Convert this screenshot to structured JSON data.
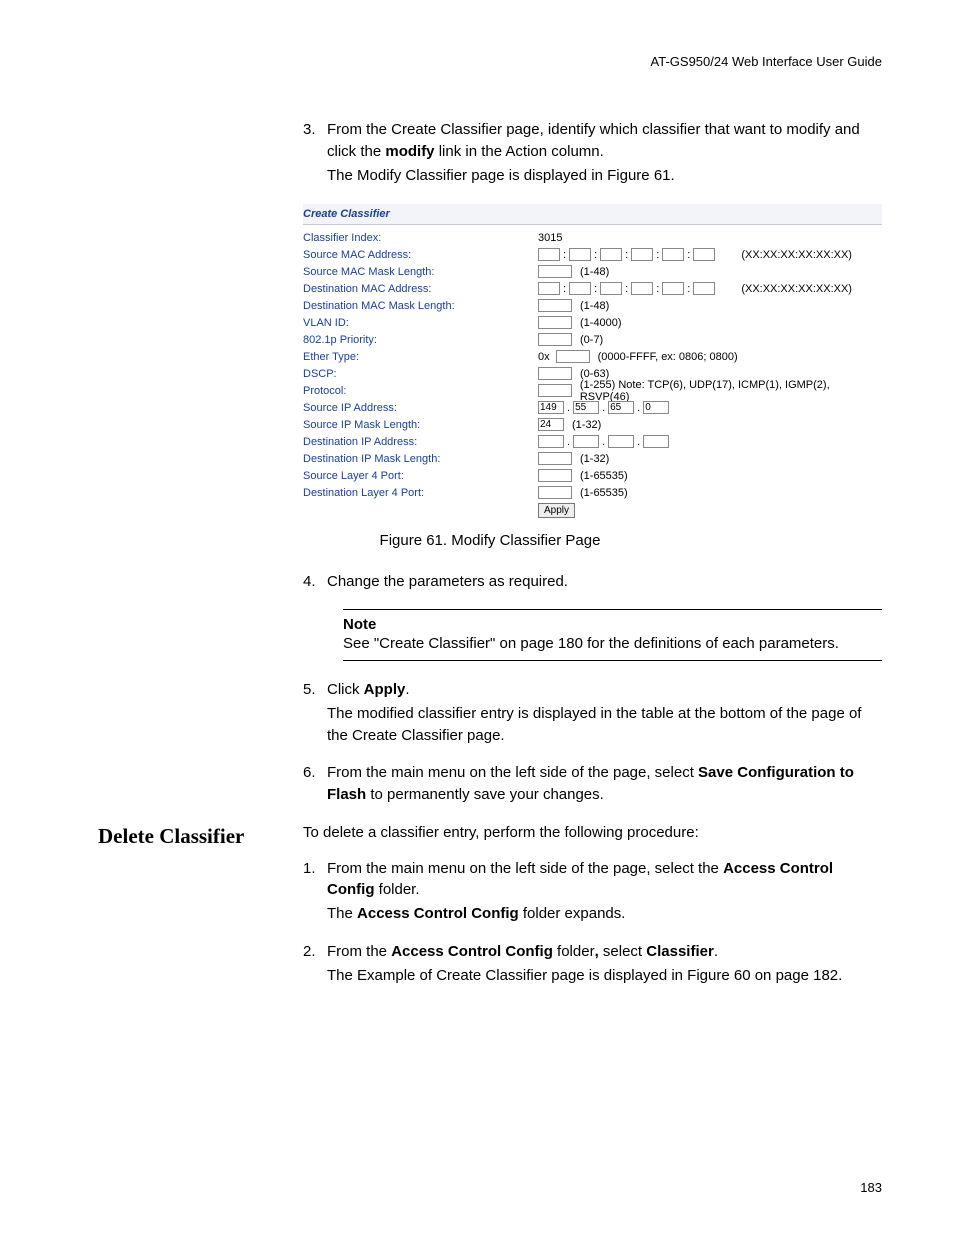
{
  "header": {
    "guide": "AT-GS950/24 Web Interface User Guide"
  },
  "step3": {
    "num": "3.",
    "line1a": "From the Create Classifier page, identify which classifier that want to modify and click the ",
    "bold1": "modify",
    "line1b": " link in the Action column.",
    "line2": "The Modify Classifier page is displayed in Figure 61."
  },
  "form": {
    "title": "Create Classifier",
    "rows": {
      "classifier_index": {
        "label": "Classifier Index:",
        "value": "3015"
      },
      "src_mac": {
        "label": "Source MAC Address:",
        "hint": "(XX:XX:XX:XX:XX:XX)"
      },
      "src_mac_mask": {
        "label": "Source MAC Mask Length:",
        "hint": "(1-48)"
      },
      "dst_mac": {
        "label": "Destination MAC Address:",
        "hint": "(XX:XX:XX:XX:XX:XX)"
      },
      "dst_mac_mask": {
        "label": "Destination MAC Mask Length:",
        "hint": "(1-48)"
      },
      "vlan": {
        "label": "VLAN ID:",
        "hint": "(1-4000)"
      },
      "prio": {
        "label": "802.1p Priority:",
        "hint": "(0-7)"
      },
      "ether": {
        "label": "Ether Type:",
        "prefix": "0x",
        "hint": "(0000-FFFF, ex: 0806; 0800)"
      },
      "dscp": {
        "label": "DSCP:",
        "hint": "(0-63)"
      },
      "proto": {
        "label": "Protocol:",
        "hint": "(1-255) Note: TCP(6), UDP(17), ICMP(1), IGMP(2), RSVP(46)"
      },
      "src_ip": {
        "label": "Source IP Address:",
        "v1": "149",
        "v2": "55",
        "v3": "65",
        "v4": "0"
      },
      "src_ip_mask": {
        "label": "Source IP Mask Length:",
        "value": "24",
        "hint": "(1-32)"
      },
      "dst_ip": {
        "label": "Destination IP Address:"
      },
      "dst_ip_mask": {
        "label": "Destination IP Mask Length:",
        "hint": "(1-32)"
      },
      "src_l4": {
        "label": "Source Layer 4 Port:",
        "hint": "(1-65535)"
      },
      "dst_l4": {
        "label": "Destination Layer 4 Port:",
        "hint": "(1-65535)"
      }
    },
    "apply": "Apply"
  },
  "caption": "Figure 61. Modify Classifier Page",
  "step4": {
    "num": "4.",
    "text": "Change the parameters as required."
  },
  "note": {
    "title": "Note",
    "body": "See \"Create Classifier\" on page 180 for the definitions of each parameters."
  },
  "step5": {
    "num": "5.",
    "l1a": "Click ",
    "b1": "Apply",
    "l1b": ".",
    "l2": "The modified classifier entry is displayed in the table at the bottom of the page of the Create Classifier page."
  },
  "step6": {
    "num": "6.",
    "l1a": "From the main menu on the left side of the page, select ",
    "b1": "Save Configuration to Flash",
    "l1b": " to permanently save your changes."
  },
  "delete": {
    "heading": "Delete Classifier",
    "intro": "To delete a classifier entry, perform the following procedure:",
    "s1": {
      "num": "1.",
      "l1a": "From the main menu on the left side of the page, select the ",
      "b1": "Access Control Config",
      "l1b": " folder.",
      "l2a": "The ",
      "b2": "Access Control Config",
      "l2b": " folder expands."
    },
    "s2": {
      "num": "2.",
      "l1a": "From the ",
      "b1": "Access Control Config",
      "l1b": " folder",
      "comma": ",",
      "l1c": " select ",
      "b2": "Classifier",
      "l1d": ".",
      "l2": "The Example of Create Classifier page is displayed in Figure 60 on page 182."
    }
  },
  "page_num": "183"
}
